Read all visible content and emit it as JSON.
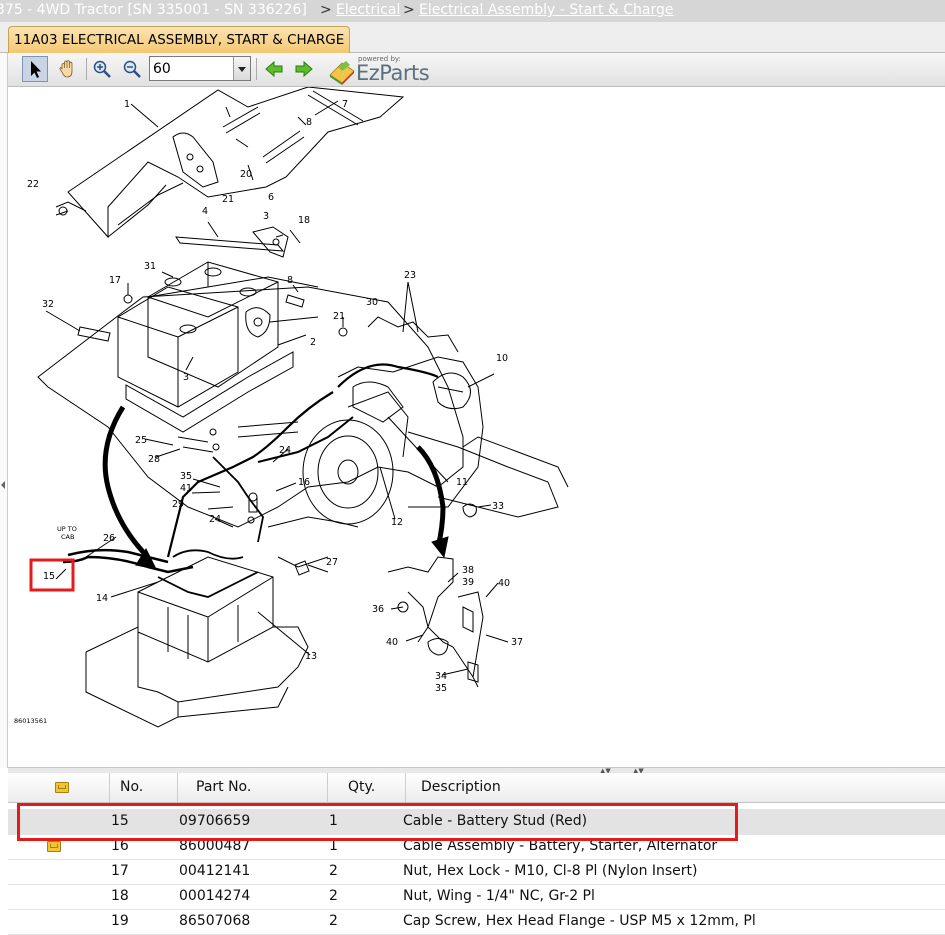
{
  "breadcrumb": {
    "model": "375 - 4WD Tractor [SN 335001 - SN 336226]",
    "sep1": ">",
    "section": "Electrical",
    "sep2": ">",
    "page": "Electrical Assembly - Start & Charge"
  },
  "tab": {
    "label": "11A03 ELECTRICAL ASSEMBLY, START & CHARGE"
  },
  "toolbar": {
    "zoom_value": "60",
    "select_tool": "select-arrow-icon",
    "pan_tool": "hand-pan-icon",
    "zoom_in": "zoom-in-icon",
    "zoom_out": "zoom-out-icon",
    "back": "arrow-left-icon",
    "forward": "arrow-right-icon",
    "logo_powered_by": "powered by:",
    "logo_name": "EzParts"
  },
  "diagram": {
    "drawing_id": "86013561",
    "up_to_cab_line1": "UP TO",
    "up_to_cab_line2": "CAB",
    "callouts": [
      "1",
      "22",
      "21",
      "20",
      "6",
      "7",
      "8",
      "3",
      "18",
      "4",
      "17",
      "31",
      "8",
      "32",
      "21",
      "2",
      "3",
      "30",
      "23",
      "10",
      "25",
      "28",
      "35",
      "41",
      "29",
      "24",
      "24",
      "16",
      "11",
      "12",
      "33",
      "26",
      "15",
      "14",
      "27",
      "13",
      "38",
      "39",
      "40",
      "36",
      "40",
      "37",
      "34",
      "35"
    ],
    "highlighted_callout": "15"
  },
  "colors": {
    "highlight": "#e31b1b",
    "selected_row": "#e3e3e3",
    "tab": "#f3c873"
  },
  "parts_table": {
    "columns": {
      "cart": "cart-icon",
      "no": "No.",
      "part_no": "Part No.",
      "qty": "Qty.",
      "description": "Description"
    },
    "rows": [
      {
        "no": "15",
        "part_no": "09706659",
        "qty": "1",
        "description": "Cable - Battery Stud (Red)",
        "cart": false,
        "selected": true
      },
      {
        "no": "16",
        "part_no": "86000487",
        "qty": "1",
        "description": "Cable Assembly - Battery, Starter, Alternator",
        "cart": true,
        "selected": false
      },
      {
        "no": "17",
        "part_no": "00412141",
        "qty": "2",
        "description": "Nut, Hex Lock - M10, Cl-8 Pl (Nylon Insert)",
        "cart": false,
        "selected": false
      },
      {
        "no": "18",
        "part_no": "00014274",
        "qty": "2",
        "description": "Nut, Wing - 1/4\" NC, Gr-2 Pl",
        "cart": false,
        "selected": false
      },
      {
        "no": "19",
        "part_no": "86507068",
        "qty": "2",
        "description": "Cap Screw, Hex Head Flange - USP M5 x 12mm, Pl",
        "cart": false,
        "selected": false
      }
    ]
  }
}
